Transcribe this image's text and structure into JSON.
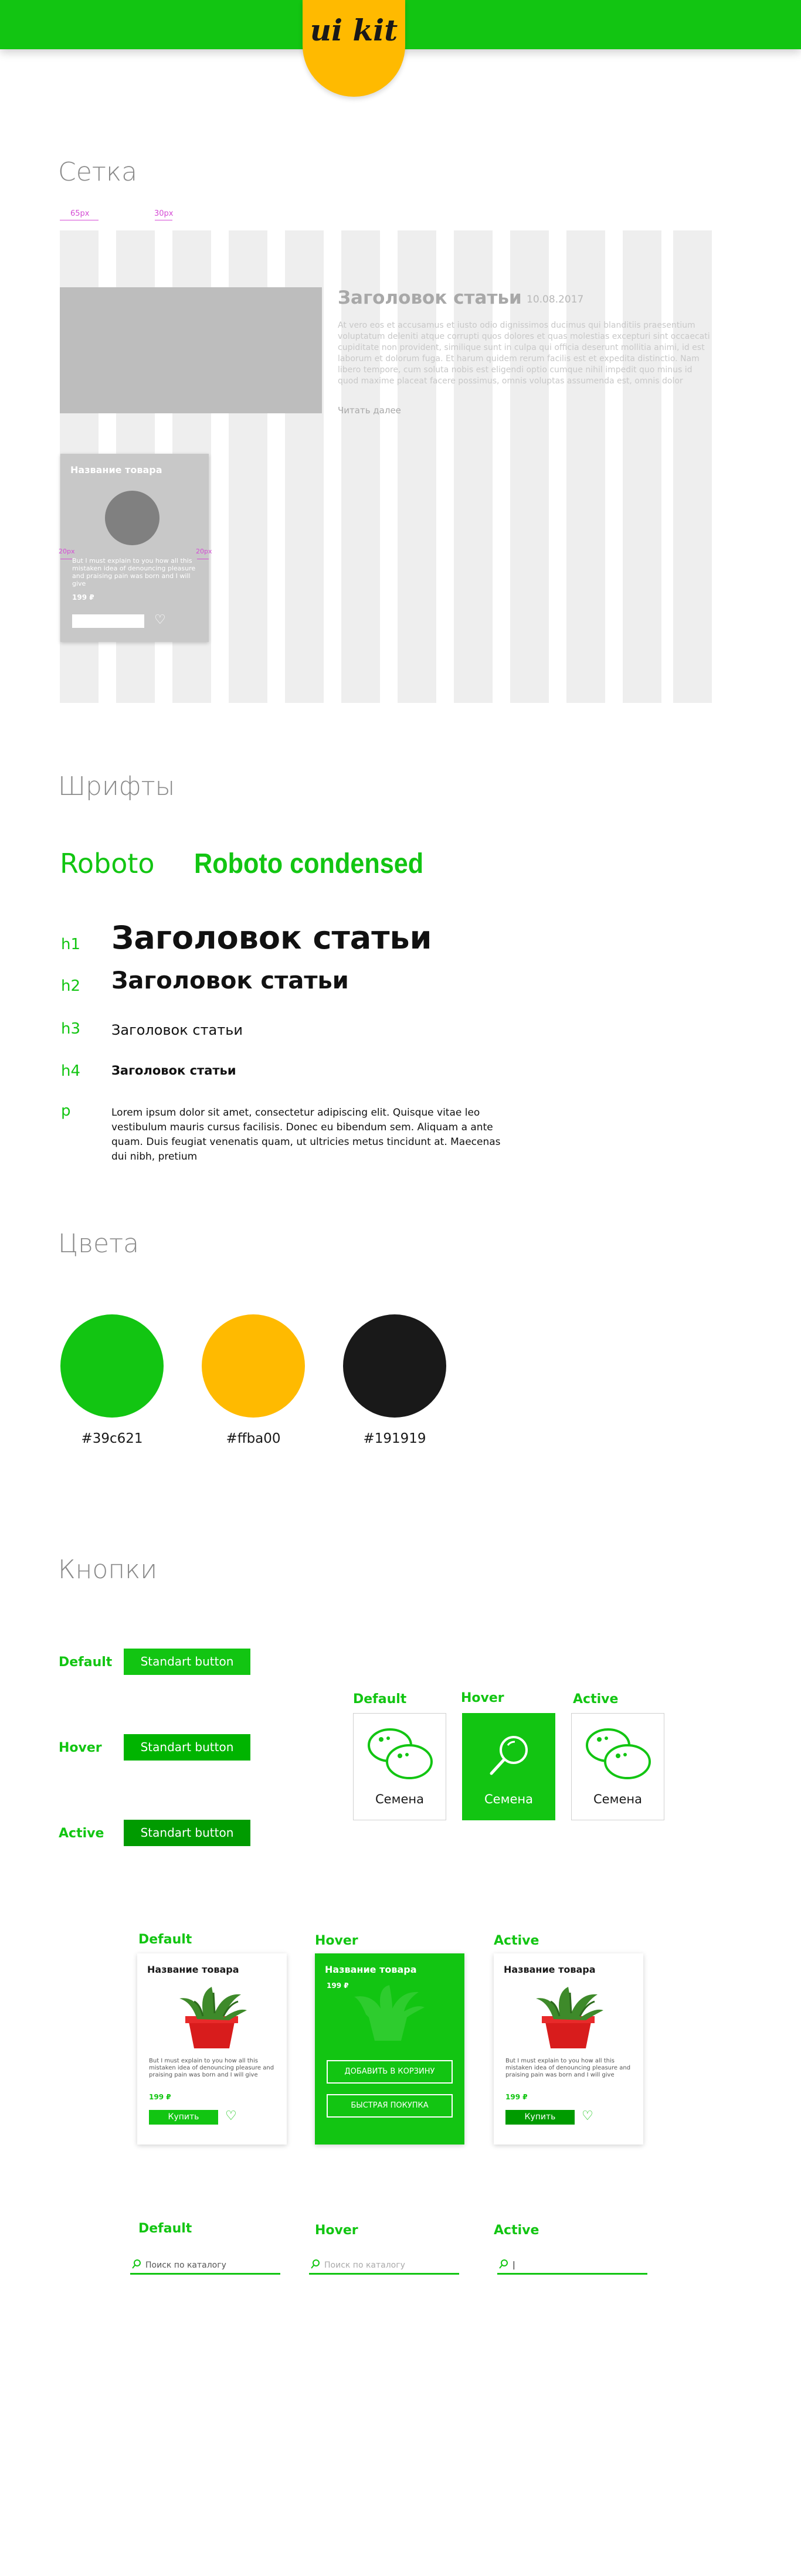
{
  "header": {
    "logo": "ui kit"
  },
  "grid": {
    "title": "Сетка",
    "gap_labels": [
      "65px",
      "30px"
    ],
    "card_gap_labels": [
      "20px",
      "20px"
    ],
    "article": {
      "title": "Заголовок статьи",
      "date": "10.08.2017",
      "body": "At vero eos et accusamus et iusto odio dignissimos ducimus qui blanditiis praesentium voluptatum deleniti atque corrupti quos dolores et quas molestias excepturi sint occaecati cupiditate non provident, similique sunt in culpa qui officia deserunt mollitia animi, id est laborum et dolorum fuga. Et harum quidem rerum facilis est et expedita distinctio. Nam libero tempore, cum soluta nobis est eligendi optio cumque nihil impedit quo minus id quod maxime placeat facere possimus, omnis voluptas assumenda est, omnis dolor",
      "read_more": "Читать далее"
    },
    "card": {
      "title": "Название товара",
      "desc": "But I must explain to you how all this mistaken idea of denouncing pleasure and praising pain was born and I will give",
      "price": "199 ₽"
    }
  },
  "fonts": {
    "title": "Шрифты",
    "families": [
      "Roboto",
      "Roboto condensed"
    ],
    "samples": [
      {
        "tag": "h1",
        "text": "Заголовок статьи"
      },
      {
        "tag": "h2",
        "text": "Заголовок статьи"
      },
      {
        "tag": "h3",
        "text": "Заголовок статьи"
      },
      {
        "tag": "h4",
        "text": "Заголовок статьи"
      },
      {
        "tag": "p",
        "text": "Lorem ipsum dolor sit amet, consectetur adipiscing elit. Quisque vitae leo vestibulum mauris cursus facilisis. Donec eu bibendum sem. Aliquam a ante quam. Duis feugiat venenatis quam, ut ultricies metus tincidunt at. Maecenas dui nibh, pretium"
      }
    ]
  },
  "colors": {
    "title": "Цвета",
    "swatches": [
      {
        "hex": "#39c621",
        "fill": "#12c512"
      },
      {
        "hex": "#ffba00",
        "fill": "#ffba00"
      },
      {
        "hex": "#191919",
        "fill": "#191919"
      }
    ]
  },
  "buttons": {
    "title": "Кнопки",
    "states": [
      "Default",
      "Hover",
      "Active"
    ],
    "standart_label": "Standart button",
    "category_label": "Семена",
    "product": {
      "title": "Название товара",
      "desc": "But I must explain to you how all this mistaken idea of denouncing pleasure and praising pain was born and I will give",
      "price": "199 ₽",
      "buy": "Купить",
      "add_to_cart": "ДОБАВИТЬ В КОРЗИНУ",
      "quick_buy": "БЫСТРАЯ ПОКУПКА"
    },
    "search": {
      "default_placeholder": "Поиск по каталогу",
      "hover_placeholder": "Поиск по каталогу",
      "active_value": "|"
    }
  },
  "palette": {
    "green": "#12c512",
    "green_hover": "#00b400",
    "green_active": "#009b00",
    "yellow": "#ffba00",
    "dark": "#191919"
  }
}
